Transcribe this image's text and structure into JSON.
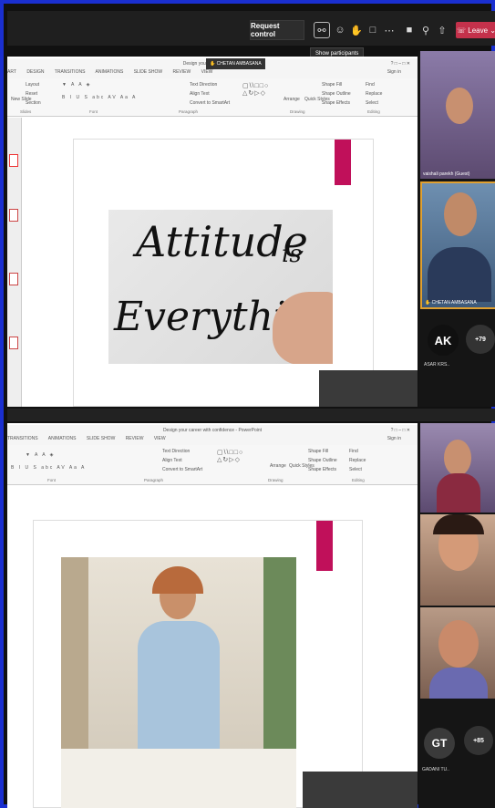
{
  "toolbar": {
    "request_control": "Request control",
    "leave": "Leave",
    "tooltip": "Show participants"
  },
  "presenter_badge": "CHETAN AMBASANA",
  "powerpoint": {
    "menu_top": [
      "ART",
      "DESIGN",
      "TRANSITIONS",
      "ANIMATIONS",
      "SLIDE SHOW",
      "REVIEW",
      "VIEW"
    ],
    "menu_bottom": [
      "TRANSITIONS",
      "ANIMATIONS",
      "SLIDE SHOW",
      "REVIEW",
      "VIEW"
    ],
    "window_title_top": "Design your career with confi",
    "window_title_bottom": "Design your career with confidence - PowerPoint",
    "sign_in": "Sign in",
    "ribbon": {
      "layout": "Layout",
      "reset": "Reset",
      "new_slide": "New Slide",
      "section": "Section",
      "text_direction": "Text Direction",
      "align_text": "Align Text",
      "convert_smartart": "Convert to SmartArt",
      "arrange": "Arrange",
      "quick_styles": "Quick Styles",
      "shape_fill": "Shape Fill",
      "shape_outline": "Shape Outline",
      "shape_effects": "Shape Effects",
      "find": "Find",
      "replace": "Replace",
      "select": "Select"
    },
    "groups": {
      "slides": "Slides",
      "font": "Font",
      "paragraph": "Paragraph",
      "drawing": "Drawing",
      "editing": "Editing"
    }
  },
  "slide_top": {
    "line1": "Attitude",
    "line1b": "is",
    "line2": "Everything"
  },
  "participants_top": [
    {
      "name": "vaishali parekh (Guest)"
    },
    {
      "name": "CHETAN AMBASANA"
    }
  ],
  "avatars_top": [
    {
      "initials": "AK",
      "name": "ASAR KRS..",
      "color": "#101010"
    },
    {
      "initials": "+79",
      "color": "#333333"
    }
  ],
  "avatars_bottom": [
    {
      "initials": "GT",
      "name": "GADANI TU..",
      "color": "#3a3a3a"
    },
    {
      "initials": "+85",
      "color": "#333333"
    }
  ]
}
